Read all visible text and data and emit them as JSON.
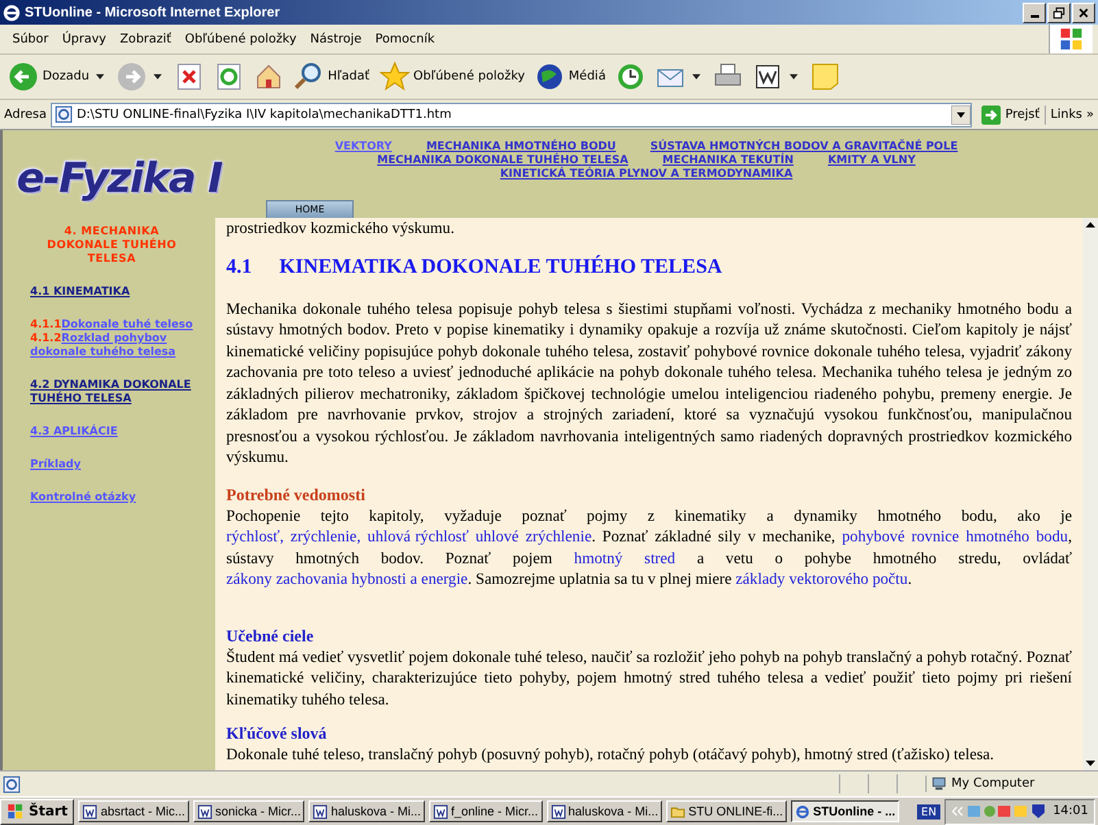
{
  "window": {
    "title": "STUonline - Microsoft Internet Explorer"
  },
  "menu": [
    "Súbor",
    "Úpravy",
    "Zobraziť",
    "Obľúbené položky",
    "Nástroje",
    "Pomocník"
  ],
  "toolbar": [
    {
      "kind": "back",
      "label": "Dozadu"
    },
    {
      "kind": "forward"
    },
    {
      "kind": "stop"
    },
    {
      "kind": "refresh"
    },
    {
      "kind": "home"
    },
    {
      "kind": "search",
      "label": "Hľadať"
    },
    {
      "kind": "favorites",
      "label": "Obľúbené položky"
    },
    {
      "kind": "media",
      "label": "Médiá"
    },
    {
      "kind": "history"
    },
    {
      "kind": "mail"
    },
    {
      "kind": "print"
    },
    {
      "kind": "word"
    },
    {
      "kind": "note"
    }
  ],
  "address": {
    "label": "Adresa",
    "value": "D:\\STU ONLINE-final\\Fyzika I\\IV kapitola\\mechanikaDTT1.htm",
    "go": "Prejsť",
    "links": "Links",
    "more": "»"
  },
  "header": {
    "logo": "e-Fyzika I",
    "nav_rows": [
      [
        "VEKTORY",
        "MECHANIKA HMOTNÉHO BODU",
        "SÚSTAVA HMOTNÝCH BODOV A GRAVITAČNÉ POLE"
      ],
      [
        "MECHANIKA DOKONALE TUHÉHO TELESA",
        "MECHANIKA TEKUTÍN",
        "KMITY A VLNY"
      ],
      [
        "KINETICKÁ TEÓRIA PLYNOV A TERMODYNAMIKA"
      ]
    ],
    "home_tab": "HOME"
  },
  "sidebar": {
    "heading": "4. MECHANIKA DOKONALE TUHÉHO TELESA",
    "items": [
      {
        "kind": "section",
        "label": "4.1 KINEMATIKA"
      },
      {
        "kind": "sub",
        "number": "4.1.1",
        "label": "Dokonale tuhé teleso"
      },
      {
        "kind": "sub",
        "number": "4.1.2",
        "label": "Rozklad pohybov dokonale tuhého telesa"
      },
      {
        "kind": "section",
        "label": "4.2 DYNAMIKA DOKONALE TUHÉHO TELESA"
      },
      {
        "kind": "link",
        "label": "4.3 APLIKÁCIE"
      },
      {
        "kind": "link",
        "label": "Príklady"
      },
      {
        "kind": "link",
        "label": "Kontrolné otázky"
      }
    ]
  },
  "content": {
    "lead": "prostriedkov kozmického výskumu.",
    "heading_number": "4.1",
    "heading": "KINEMATIKA DOKONALE TUHÉHO TELESA",
    "intro": "Mechanika dokonale tuhého telesa popisuje pohyb telesa s šiestimi stupňami voľnosti. Vychádza z mechaniky hmotného bodu a sústavy hmotných bodov. Preto v popise kinematiky i dynamiky opakuje a rozvíja už známe skutočnosti. Cieľom kapitoly je nájsť kinematické veličiny popisujúce pohyb dokonale tuhého telesa, zostaviť pohybové rovnice dokonale tuhého telesa, vyjadriť zákony zachovania pre toto teleso a uviesť jednoduché aplikácie na pohyb dokonale tuhého telesa. Mechanika tuhého telesa je jedným zo základných pilierov mechatroniky, základom špičkovej technológie umelou inteligenciou riadeného pohybu, premeny energie. Je základom pre navrhovanie prvkov, strojov a strojných zariadení, ktoré sa vyznačujú vysokou funkčnosťou, manipulačnou presnosťou a vysokou rýchlosťou. Je základom navrhovania inteligentných samo riadených dopravných prostriedkov kozmického výskumu.",
    "sections": [
      {
        "heading": "Potrebné vedomosti",
        "color": "#c8401c",
        "segments": [
          {
            "kind": "text",
            "text": "Pochopenie tejto kapitoly, vyžaduje poznať pojmy z kinematiky a dynamiky hmotného bodu, ako je "
          },
          {
            "kind": "link",
            "text": "rýchlosť, zrýchlenie, uhlová"
          },
          {
            "kind": "link",
            "text": "rýchlosť uhlové zrýchlenie"
          },
          {
            "kind": "text",
            "text": ". Poznať základné sily v mechanike, "
          },
          {
            "kind": "link",
            "text": "pohybové rovnice hmotného bodu"
          },
          {
            "kind": "text",
            "text": ", sústavy hmotných bodov. Poznať pojem "
          },
          {
            "kind": "link",
            "text": "hmotný stred"
          },
          {
            "kind": "text",
            "text": " a vetu o pohybe hmotného stredu, ovládať "
          },
          {
            "kind": "link",
            "text": "zákony zachovania hybnosti a energie"
          },
          {
            "kind": "text",
            "text": ". Samozrejme uplatnia sa tu v plnej miere "
          },
          {
            "kind": "link",
            "text": "základy vektorového počtu"
          },
          {
            "kind": "text",
            "text": "."
          }
        ]
      },
      {
        "heading": "Učebné ciele",
        "color": "#2222cc",
        "segments": [
          {
            "kind": "text",
            "text": "Študent má vedieť vysvetliť pojem dokonale tuhé teleso, naučiť sa rozložiť jeho pohyb na pohyb translačný a pohyb rotačný. Poznať kinematické veličiny, charakterizujúce tieto pohyby, pojem hmotný stred tuhého telesa a vedieť použiť tieto pojmy pri riešení kinematiky tuhého telesa."
          }
        ]
      },
      {
        "heading": "Kľúčové slová",
        "color": "#2222cc",
        "segments": [
          {
            "kind": "text",
            "text": "Dokonale tuhé teleso, translačný pohyb (posuvný pohyb), rotačný pohyb (otáčavý pohyb), hmotný stred (ťažisko) telesa."
          }
        ]
      }
    ]
  },
  "status_bar": {
    "zone": "My Computer"
  },
  "taskbar": {
    "start": "Štart",
    "tasks": [
      {
        "kind": "word",
        "label": "absrtact - Mic...",
        "selected": false
      },
      {
        "kind": "word",
        "label": "sonicka - Micr...",
        "selected": false
      },
      {
        "kind": "word",
        "label": "haluskova - Mi...",
        "selected": false
      },
      {
        "kind": "word",
        "label": "f_online - Micr...",
        "selected": false
      },
      {
        "kind": "word",
        "label": "haluskova - Mi...",
        "selected": false
      },
      {
        "kind": "folder",
        "label": "STU ONLINE-fi...",
        "selected": false
      },
      {
        "kind": "ie",
        "label": "STUonline - ...",
        "selected": true
      }
    ],
    "lang": "EN",
    "clock": "14:01"
  }
}
